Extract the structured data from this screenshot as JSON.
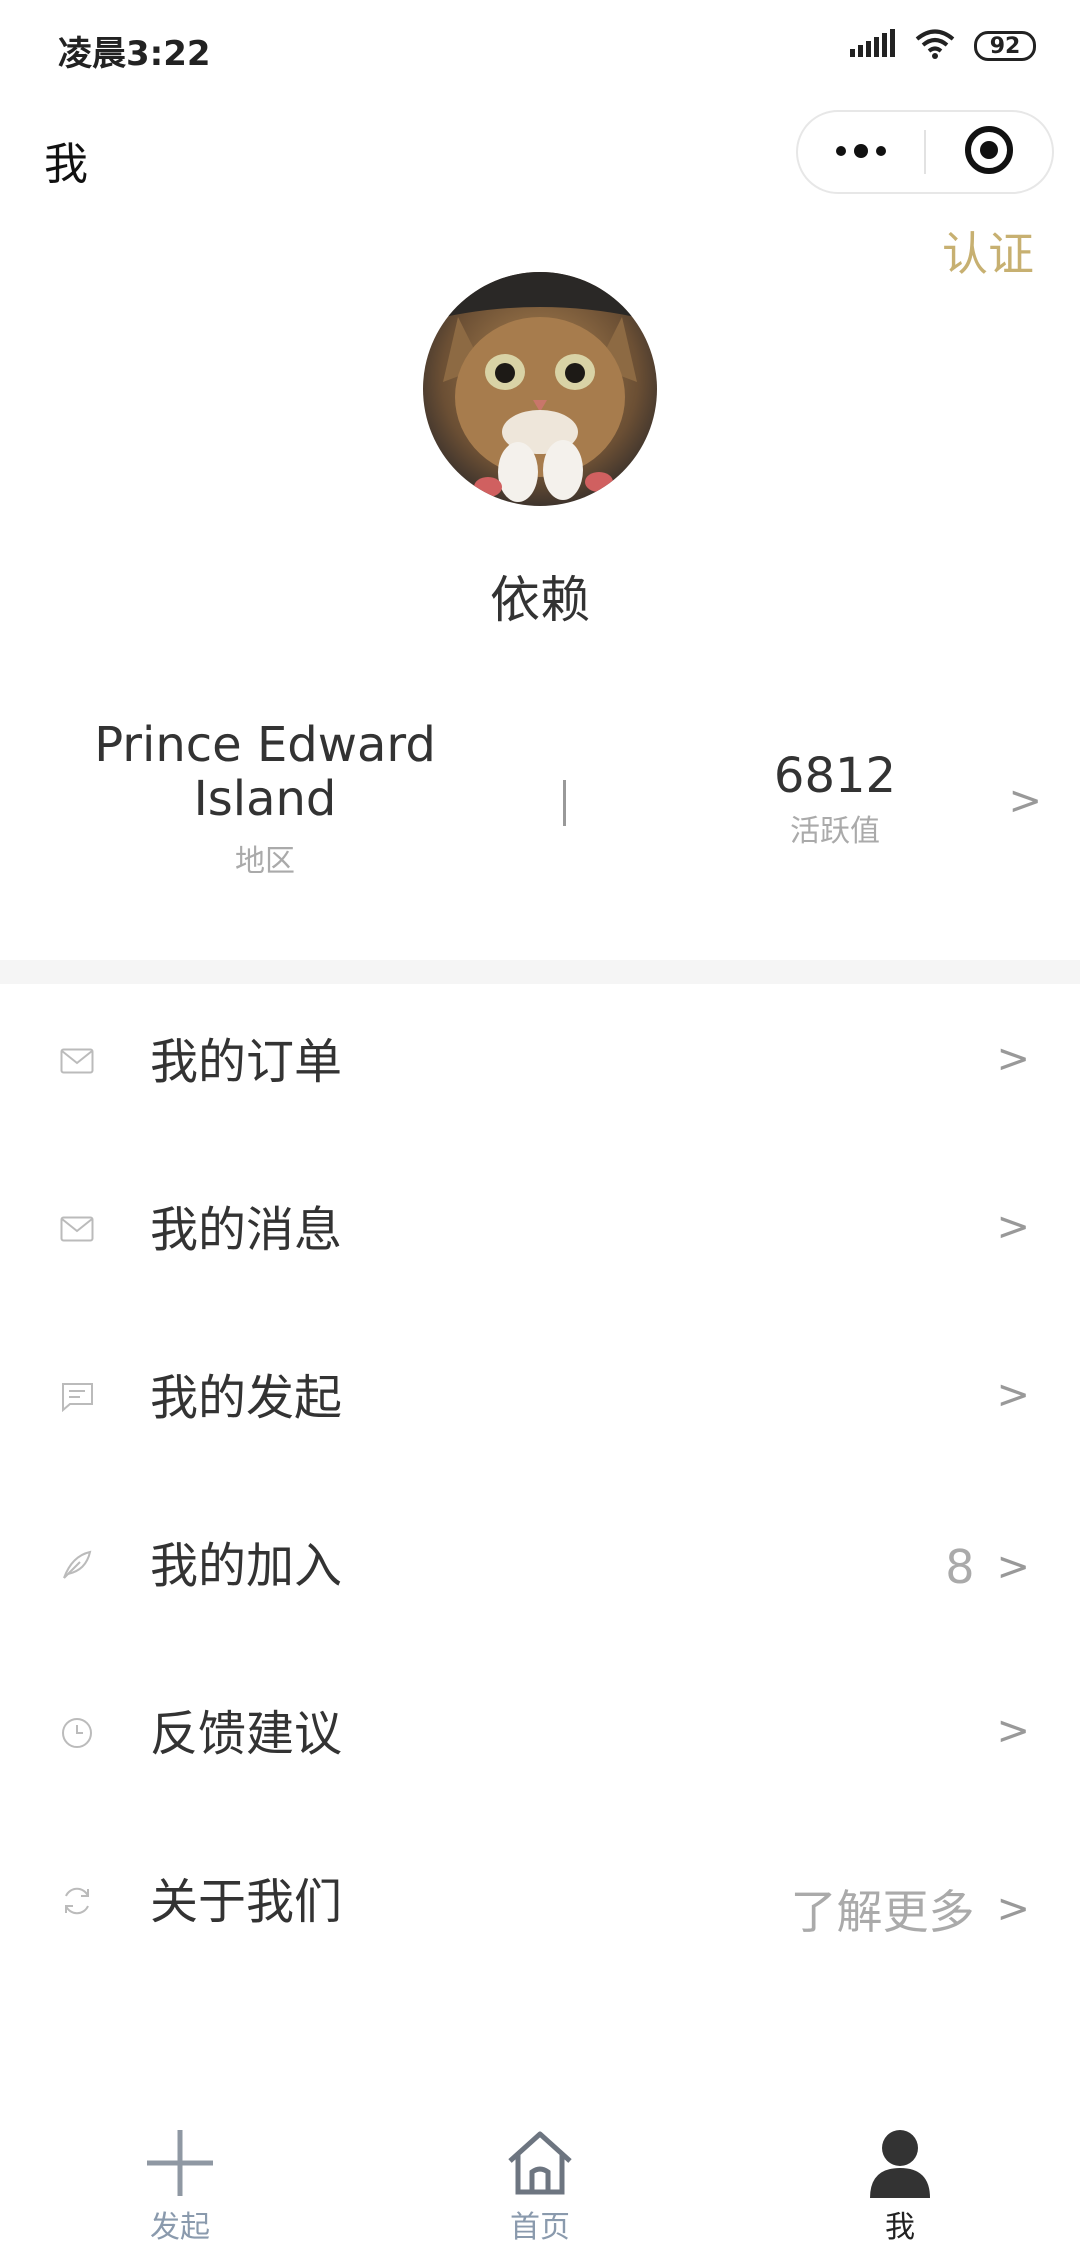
{
  "status_bar": {
    "time": "凌晨3:22",
    "battery": "92"
  },
  "nav": {
    "title": "我"
  },
  "certify_label": "认证",
  "profile": {
    "username": "依赖"
  },
  "stats": {
    "region_value": "Prince Edward Island",
    "region_label": "地区",
    "activity_value": "6812",
    "activity_label": "活跃值",
    "arrow": ">"
  },
  "menu": {
    "items": [
      {
        "label": "我的订单",
        "icon": "mail-icon",
        "extra": "",
        "arrow": ">"
      },
      {
        "label": "我的消息",
        "icon": "mail-icon",
        "extra": "",
        "arrow": ">"
      },
      {
        "label": "我的发起",
        "icon": "message-icon",
        "extra": "",
        "arrow": ">"
      },
      {
        "label": "我的加入",
        "icon": "feather-icon",
        "extra": "8",
        "arrow": ">"
      },
      {
        "label": "反馈建议",
        "icon": "clock-icon",
        "extra": "",
        "arrow": ">"
      },
      {
        "label": "关于我们",
        "icon": "refresh-icon",
        "extra": "了解更多",
        "arrow": ">"
      }
    ]
  },
  "tabbar": {
    "tabs": [
      {
        "label": "发起",
        "icon": "plus-icon",
        "active": false
      },
      {
        "label": "首页",
        "icon": "home-icon",
        "active": false
      },
      {
        "label": "我",
        "icon": "user-icon",
        "active": true
      }
    ]
  },
  "colors": {
    "accent_gold": "#c7b071",
    "text_primary": "#333333",
    "text_secondary": "#aaaaaa",
    "tab_inactive": "#8a9aad"
  }
}
